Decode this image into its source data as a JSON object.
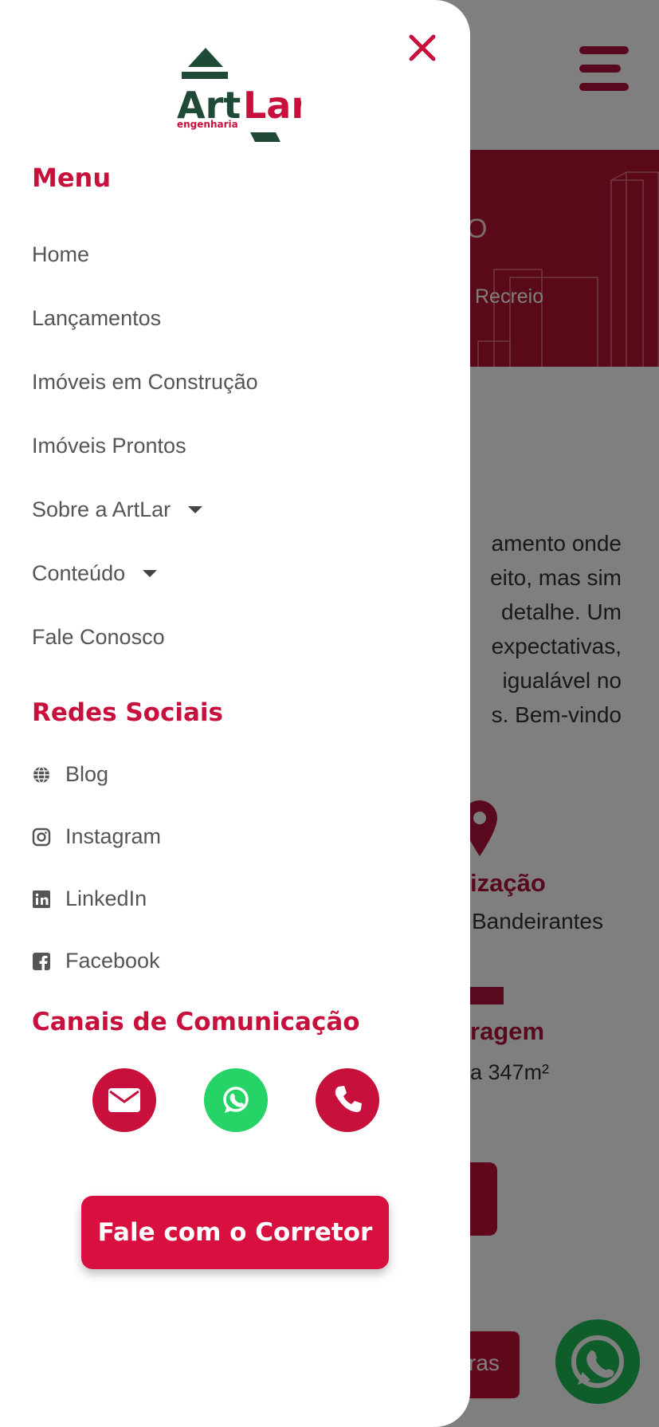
{
  "background": {
    "hero_text": "Recreio",
    "hero_letter": "O",
    "intro_lines": [
      "amento onde",
      "eito, mas sim",
      "detalhe. Um",
      "expectativas,",
      "igualável no",
      "s. Bem-vindo"
    ],
    "location_title": "ização",
    "location_text": "Bandeirantes",
    "size_title": "ragem",
    "size_text": "a 347m²",
    "button_text": "ras"
  },
  "drawer": {
    "logo": {
      "main": "ArtLar",
      "sub": "engenharia"
    },
    "menu_title": "Menu",
    "menu_items": [
      {
        "label": "Home"
      },
      {
        "label": "Lançamentos"
      },
      {
        "label": "Imóveis em Construção"
      },
      {
        "label": "Imóveis Prontos"
      },
      {
        "label": "Sobre a ArtLar"
      },
      {
        "label": "Conteúdo"
      },
      {
        "label": "Fale Conosco"
      }
    ],
    "social_title": "Redes Sociais",
    "social_items": [
      {
        "label": "Blog",
        "icon": "globe-icon"
      },
      {
        "label": "Instagram",
        "icon": "instagram-icon"
      },
      {
        "label": "LinkedIn",
        "icon": "linkedin-icon"
      },
      {
        "label": "Facebook",
        "icon": "facebook-icon"
      }
    ],
    "channels_title": "Canais de Comunicação",
    "channels": [
      {
        "icon": "email-icon",
        "color": "#c8103c"
      },
      {
        "icon": "whatsapp-icon",
        "color": "#25d366"
      },
      {
        "icon": "phone-icon",
        "color": "#c8103c"
      }
    ],
    "cta_label": "Fale com o Corretor"
  },
  "colors": {
    "accent": "#c8103c",
    "logo_green": "#1f4a35",
    "whatsapp": "#25d366"
  }
}
